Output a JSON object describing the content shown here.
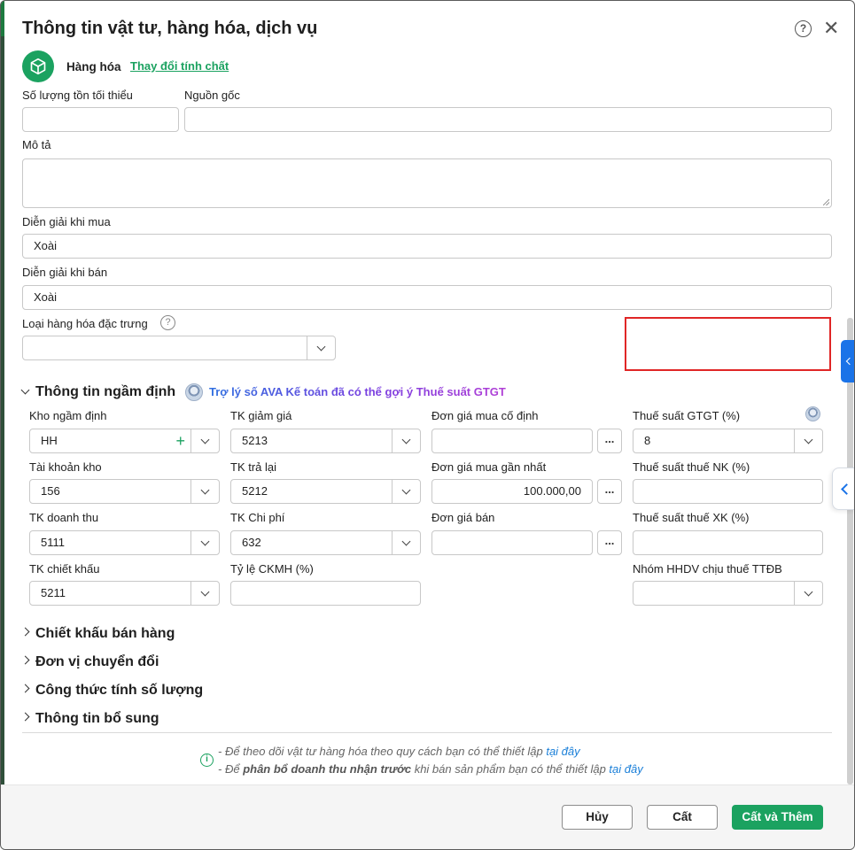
{
  "dialog": {
    "title": "Thông tin vật tư, hàng hóa, dịch vụ",
    "help_symbol": "?",
    "close_symbol": "✕"
  },
  "item_type": {
    "name": "Hàng hóa",
    "change_link": "Thay đổi tính chất",
    "icon": "package-box-icon"
  },
  "fields": {
    "min_stock_label": "Số lượng tồn tối thiểu",
    "min_stock_value": "",
    "origin_label": "Nguồn gốc",
    "origin_value": "",
    "description_label": "Mô tả",
    "purchase_desc_label": "Diễn giải khi mua",
    "purchase_desc_value": "Xoài",
    "sale_desc_label": "Diễn giải khi bán",
    "sale_desc_value": "Xoài",
    "special_type_label": "Loại hàng hóa đặc trưng",
    "special_type_value": ""
  },
  "default_section": {
    "title": "Thông tin ngầm định",
    "ai_hint": "Trợ lý số AVA Kế toán đã có thể gợi ý Thuế suất GTGT",
    "default_warehouse_label": "Kho ngầm định",
    "default_warehouse_value": "HH",
    "discount_account_label": "TK giảm giá",
    "discount_account_value": "5213",
    "fixed_purchase_price_label": "Đơn giá mua cố định",
    "fixed_purchase_price_value": "",
    "vat_rate_label": "Thuế suất GTGT (%)",
    "vat_rate_value": "8",
    "stock_account_label": "Tài khoản kho",
    "stock_account_value": "156",
    "return_account_label": "TK trả lại",
    "return_account_value": "5212",
    "latest_purchase_price_label": "Đơn giá mua gần nhất",
    "latest_purchase_price_value": "100.000,00",
    "import_tax_label": "Thuế suất thuế NK (%)",
    "import_tax_value": "",
    "revenue_account_label": "TK doanh thu",
    "revenue_account_value": "5111",
    "expense_account_label": "TK Chi phí",
    "expense_account_value": "632",
    "sale_price_label": "Đơn giá bán",
    "sale_price_value": "",
    "export_tax_label": "Thuế suất thuế XK (%)",
    "export_tax_value": "",
    "trade_discount_account_label": "TK chiết khấu",
    "trade_discount_account_value": "5211",
    "promo_rate_label": "Tỷ lệ CKMH (%)",
    "promo_rate_value": "",
    "special_tax_group_label": "Nhóm HHDV chịu thuế TTĐB",
    "special_tax_group_value": "",
    "dots": "..."
  },
  "collapsed_sections": [
    "Chiết khấu bán hàng",
    "Đơn vị chuyển đổi",
    "Công thức tính số lượng",
    "Thông tin bổ sung"
  ],
  "notes": {
    "line1_text": "- Để theo dõi vật tư hàng hóa theo quy cách bạn có thể thiết lập",
    "line1_link": "tại đây",
    "line2_prefix": "- Để",
    "line2_bold": "phân bổ doanh thu nhận trước",
    "line2_suffix": "khi bán sản phẩm bạn có thể thiết lập",
    "line2_link": "tại đây",
    "info_symbol": "i"
  },
  "buttons": {
    "cancel": "Hủy",
    "save": "Cất",
    "save_and_add": "Cất và Thêm"
  },
  "colors": {
    "brand_green": "#1ba260",
    "accent_blue": "#1a73e8",
    "highlight_red": "#e02626"
  }
}
